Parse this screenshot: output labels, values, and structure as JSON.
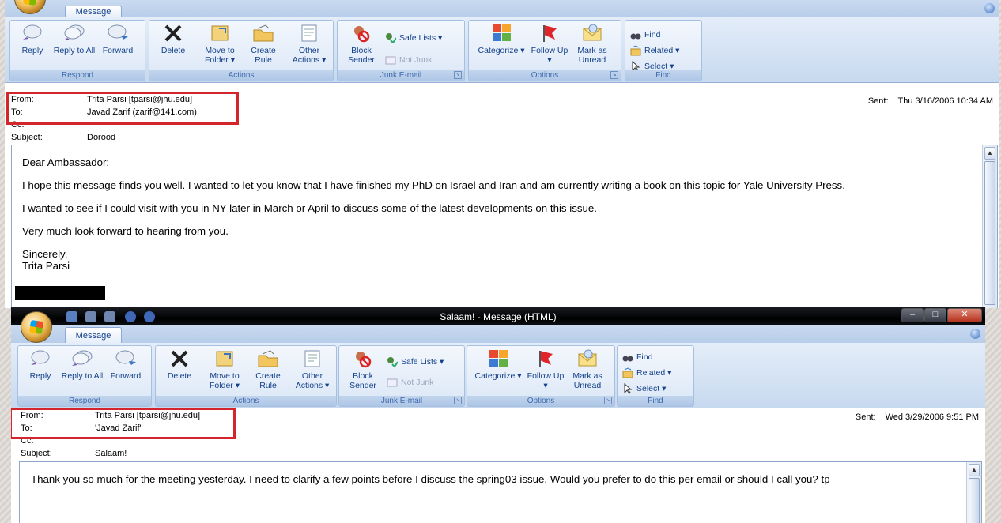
{
  "ribbon": {
    "tab_label": "Message",
    "groups": {
      "respond": {
        "label": "Respond",
        "reply": "Reply",
        "reply_all": "Reply to All",
        "forward": "Forward"
      },
      "actions": {
        "label": "Actions",
        "delete": "Delete",
        "move": "Move to Folder ▾",
        "rule": "Create Rule",
        "other": "Other Actions ▾"
      },
      "junk": {
        "label": "Junk E-mail",
        "block": "Block Sender",
        "safe": "Safe Lists ▾",
        "notjunk": "Not Junk"
      },
      "options": {
        "label": "Options",
        "categorize": "Categorize ▾",
        "follow": "Follow Up ▾",
        "mark": "Mark as Unread"
      },
      "find": {
        "label": "Find",
        "find": "Find",
        "related": "Related ▾",
        "select": "Select ▾"
      }
    }
  },
  "message1": {
    "from_label": "From:",
    "from": "Trita Parsi [tparsi@jhu.edu]",
    "to_label": "To:",
    "to": "Javad Zarif (zarif@141.com)",
    "cc_label": "Cc:",
    "subject_label": "Subject:",
    "subject": "Dorood",
    "sent_label": "Sent:",
    "sent": "Thu 3/16/2006 10:34 AM",
    "body": {
      "greeting": "Dear Ambassador:",
      "p1": "I hope this message finds you well. I wanted to let you know that I have finished my PhD on Israel and Iran and am currently writing a book on this topic for Yale University Press.",
      "p2": "I wanted to see if I could visit with you in NY later in March or April to discuss some of the latest developments on this issue.",
      "p3": "Very much look forward to hearing from you.",
      "closing": "Sincerely,",
      "signature": "Trita Parsi"
    }
  },
  "message2": {
    "window_title": "Salaam! - Message (HTML)",
    "from_label": "From:",
    "from": "Trita Parsi [tparsi@jhu.edu]",
    "to_label": "To:",
    "to": "'Javad Zarif'",
    "cc_label": "Cc:",
    "subject_label": "Subject:",
    "subject": "Salaam!",
    "sent_label": "Sent:",
    "sent": "Wed 3/29/2006 9:51 PM",
    "body": {
      "p1": "Thank you so much for the meeting yesterday. I need to clarify a few points before I discuss the spring03 issue. Would you prefer to do this per email or should I call you? tp"
    }
  },
  "colors": {
    "highlight_box": "#d4242c",
    "ribbon_text": "#15428b"
  }
}
